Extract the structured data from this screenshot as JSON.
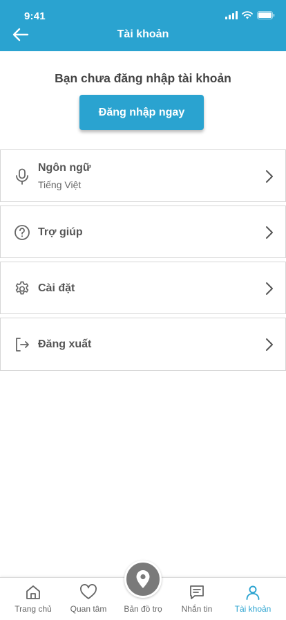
{
  "status_bar": {
    "time": "9:41"
  },
  "header": {
    "title": "Tài khoản"
  },
  "login": {
    "prompt": "Bạn chưa đăng nhập tài khoản",
    "button_label": "Đăng nhập ngay"
  },
  "menu": [
    {
      "label": "Ngôn ngữ",
      "sublabel": "Tiếng Việt",
      "icon": "microphone-icon"
    },
    {
      "label": "Trợ giúp",
      "icon": "help-circle-icon"
    },
    {
      "label": "Cài đặt",
      "icon": "gear-icon"
    },
    {
      "label": "Đăng xuất",
      "icon": "logout-icon"
    }
  ],
  "tabs": [
    {
      "label": "Trang chủ",
      "icon": "home-icon",
      "active": false
    },
    {
      "label": "Quan tâm",
      "icon": "heart-icon",
      "active": false
    },
    {
      "label": "Bản đồ trọ",
      "icon": "map-pin-icon",
      "active": false
    },
    {
      "label": "Nhắn tin",
      "icon": "chat-icon",
      "active": false
    },
    {
      "label": "Tài khoản",
      "icon": "user-icon",
      "active": true
    }
  ],
  "colors": {
    "accent": "#2aa3d0",
    "icon_gray": "#666666",
    "fab_gray": "#7a7a7a"
  }
}
